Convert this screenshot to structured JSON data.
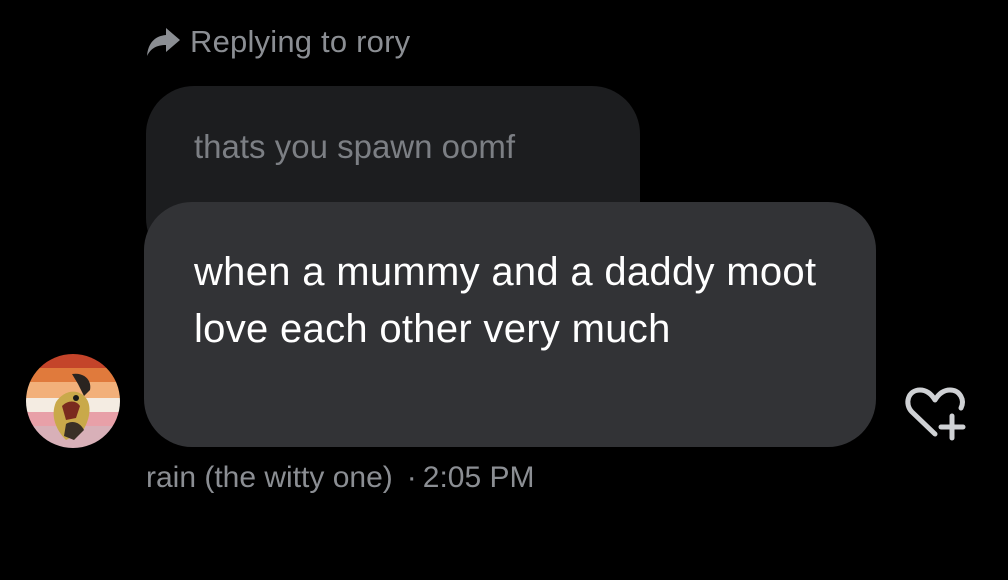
{
  "reply": {
    "label": "Replying to rory",
    "icon": "reply-arrow-icon"
  },
  "quoted_message": {
    "text": "thats you spawn oomf"
  },
  "message": {
    "text": "when a mummy and a daddy moot love each other very much"
  },
  "sender": {
    "name": "rain (the witty one)",
    "separator": "·",
    "time": "2:05 PM",
    "avatar_icon": "avatar-image"
  },
  "reaction": {
    "icon": "heart-plus-icon"
  },
  "colors": {
    "background": "#000000",
    "bubble": "#323336",
    "quoted_bubble": "#1c1d1f",
    "muted_text": "#8b8e93",
    "message_text": "#ffffff"
  }
}
